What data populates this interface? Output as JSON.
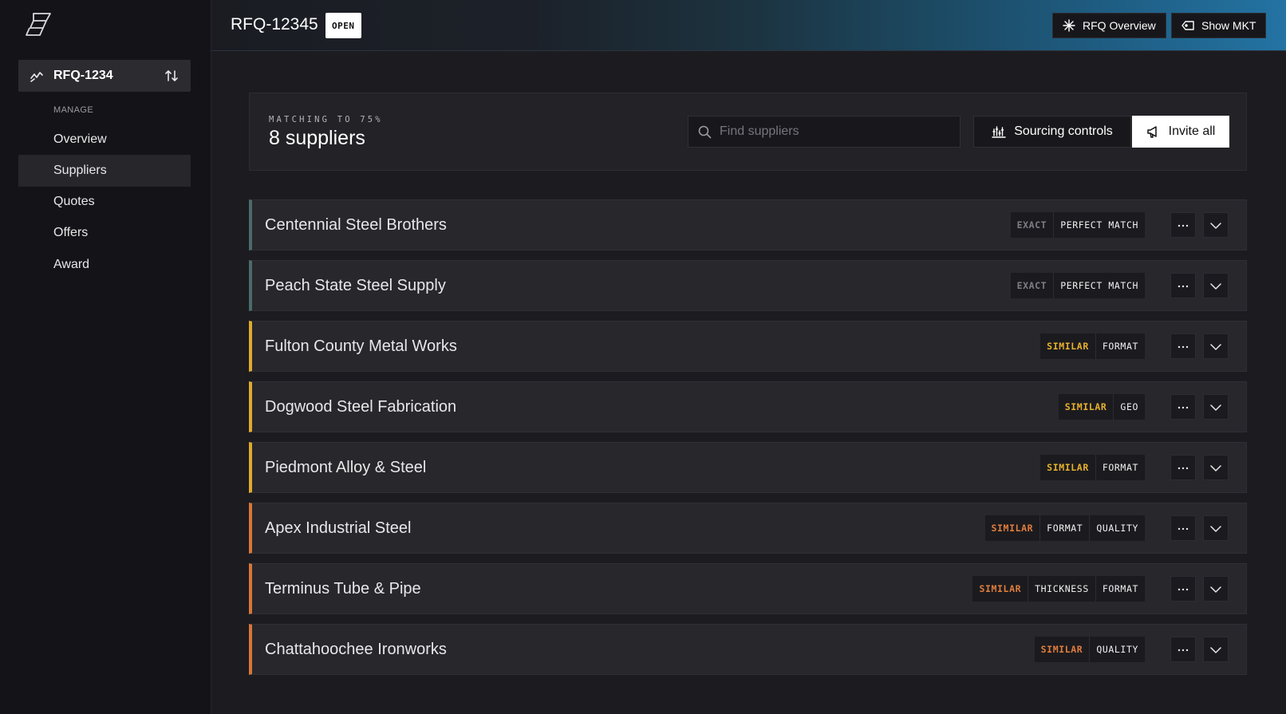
{
  "sidebar": {
    "logo_icon": "app-logo-icon",
    "rfq_switcher": {
      "label": "RFQ-1234",
      "icon": "activity-icon",
      "swap_icon": "swap-sort-icon"
    },
    "section_label": "MANAGE",
    "items": [
      {
        "label": "Overview",
        "active": false
      },
      {
        "label": "Suppliers",
        "active": true
      },
      {
        "label": "Quotes",
        "active": false
      },
      {
        "label": "Offers",
        "active": false
      },
      {
        "label": "Award",
        "active": false
      }
    ]
  },
  "header": {
    "title": "RFQ-12345",
    "status": "OPEN",
    "buttons": {
      "overview": {
        "label": "RFQ Overview",
        "icon": "sparkle-icon"
      },
      "market": {
        "label": "Show MKT",
        "icon": "tag-arrow-icon"
      }
    }
  },
  "summary": {
    "matching_label": "MATCHING TO 75%",
    "count_label": "8 suppliers",
    "search": {
      "placeholder": "Find suppliers",
      "value": ""
    },
    "sourcing_button": "Sourcing controls",
    "invite_button": "Invite all"
  },
  "colors": {
    "exact": "#4b6b6b",
    "similar_yellow": "#e0aa2b",
    "similar_orange": "#d9763a"
  },
  "suppliers": [
    {
      "name": "Centennial Steel Brothers",
      "match": "EXACT",
      "level": "exact",
      "tags": [
        "PERFECT MATCH"
      ]
    },
    {
      "name": "Peach State Steel Supply",
      "match": "EXACT",
      "level": "exact",
      "tags": [
        "PERFECT MATCH"
      ]
    },
    {
      "name": "Fulton County Metal Works",
      "match": "SIMILAR",
      "level": "yellow",
      "tags": [
        "FORMAT"
      ]
    },
    {
      "name": "Dogwood Steel Fabrication",
      "match": "SIMILAR",
      "level": "yellow",
      "tags": [
        "GEO"
      ]
    },
    {
      "name": "Piedmont Alloy & Steel",
      "match": "SIMILAR",
      "level": "yellow",
      "tags": [
        "FORMAT"
      ]
    },
    {
      "name": "Apex Industrial Steel",
      "match": "SIMILAR",
      "level": "orange",
      "tags": [
        "FORMAT",
        "QUALITY"
      ]
    },
    {
      "name": "Terminus Tube & Pipe",
      "match": "SIMILAR",
      "level": "orange",
      "tags": [
        "THICKNESS",
        "FORMAT"
      ]
    },
    {
      "name": "Chattahoochee Ironworks",
      "match": "SIMILAR",
      "level": "orange",
      "tags": [
        "QUALITY"
      ]
    }
  ]
}
